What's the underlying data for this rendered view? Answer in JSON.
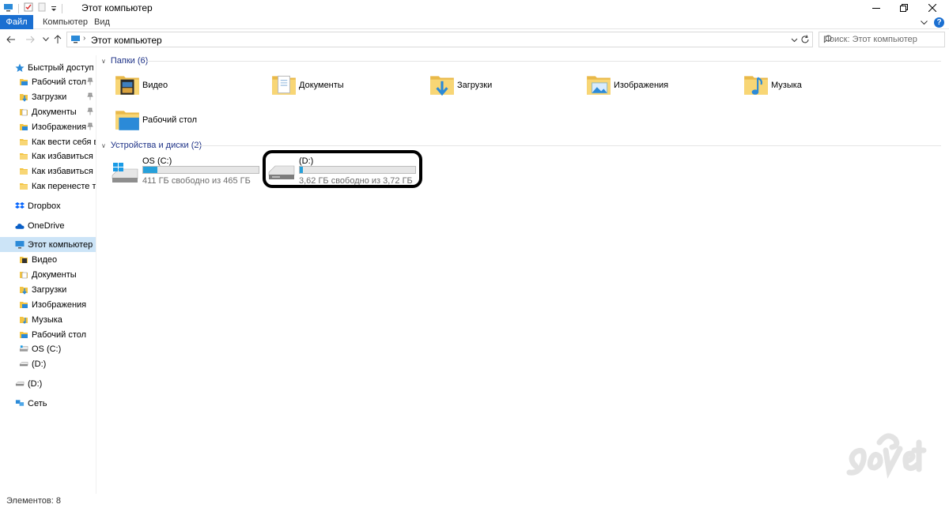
{
  "window": {
    "title": "Этот компьютер"
  },
  "ribbon": {
    "tabs": [
      "Файл",
      "Компьютер",
      "Вид"
    ]
  },
  "address": {
    "crumb": "Этот компьютер",
    "search_placeholder": "Поиск: Этот компьютер"
  },
  "sidebar": {
    "items": [
      {
        "label": "Быстрый доступ",
        "icon": "star-icon",
        "indent": 0,
        "pinned": false
      },
      {
        "label": "Рабочий стол",
        "icon": "desktop-folder-icon",
        "indent": 1,
        "pinned": true
      },
      {
        "label": "Загрузки",
        "icon": "downloads-folder-icon",
        "indent": 1,
        "pinned": true
      },
      {
        "label": "Документы",
        "icon": "documents-folder-icon",
        "indent": 1,
        "pinned": true
      },
      {
        "label": "Изображения",
        "icon": "pictures-folder-icon",
        "indent": 1,
        "pinned": true
      },
      {
        "label": "Как вести себя во",
        "icon": "folder-icon",
        "indent": 1,
        "pinned": false
      },
      {
        "label": "Как избавиться от",
        "icon": "folder-icon",
        "indent": 1,
        "pinned": false
      },
      {
        "label": "Как избавиться от",
        "icon": "folder-icon",
        "indent": 1,
        "pinned": false
      },
      {
        "label": "Как перенесте табл",
        "icon": "folder-icon",
        "indent": 1,
        "pinned": false
      },
      {
        "label": "Dropbox",
        "icon": "dropbox-icon",
        "indent": 0,
        "pinned": false
      },
      {
        "label": "OneDrive",
        "icon": "onedrive-icon",
        "indent": 0,
        "pinned": false
      },
      {
        "label": "Этот компьютер",
        "icon": "computer-icon",
        "indent": 0,
        "pinned": false,
        "selected": true
      },
      {
        "label": "Видео",
        "icon": "video-folder-icon",
        "indent": 1,
        "pinned": false
      },
      {
        "label": "Документы",
        "icon": "documents-folder-icon",
        "indent": 1,
        "pinned": false
      },
      {
        "label": "Загрузки",
        "icon": "downloads-folder-icon",
        "indent": 1,
        "pinned": false
      },
      {
        "label": "Изображения",
        "icon": "pictures-folder-icon",
        "indent": 1,
        "pinned": false
      },
      {
        "label": "Музыка",
        "icon": "music-folder-icon",
        "indent": 1,
        "pinned": false
      },
      {
        "label": "Рабочий стол",
        "icon": "desktop-folder-icon",
        "indent": 1,
        "pinned": false
      },
      {
        "label": "OS (C:)",
        "icon": "drive-icon",
        "indent": 1,
        "pinned": false
      },
      {
        "label": "(D:)",
        "icon": "removable-drive-icon",
        "indent": 1,
        "pinned": false
      },
      {
        "label": "(D:)",
        "icon": "removable-drive-icon",
        "indent": 0,
        "pinned": false
      },
      {
        "label": "Сеть",
        "icon": "network-icon",
        "indent": 0,
        "pinned": false
      }
    ]
  },
  "main": {
    "folders_header": "Папки (6)",
    "folders": [
      {
        "label": "Видео",
        "icon": "video-folder-icon"
      },
      {
        "label": "Документы",
        "icon": "documents-folder-icon"
      },
      {
        "label": "Загрузки",
        "icon": "downloads-folder-icon"
      },
      {
        "label": "Изображения",
        "icon": "pictures-folder-icon"
      },
      {
        "label": "Музыка",
        "icon": "music-folder-icon"
      },
      {
        "label": "Рабочий стол",
        "icon": "desktop-folder-icon"
      }
    ],
    "devices_header": "Устройства и диски (2)",
    "drives": [
      {
        "label": "OS (C:)",
        "free": "411 ГБ свободно из 465 ГБ",
        "used_fraction": 0.12,
        "icon": "windows-drive-icon"
      },
      {
        "label": "(D:)",
        "free": "3,62 ГБ свободно из 3,72 ГБ",
        "used_fraction": 0.03,
        "icon": "removable-drive-icon"
      }
    ]
  },
  "status": {
    "items_count": "Элементов: 8"
  },
  "colors": {
    "accent": "#1a6fd1",
    "header_text": "#1e3287",
    "selected_bg": "#cce4f7",
    "bar_fill": "#26a0da"
  }
}
